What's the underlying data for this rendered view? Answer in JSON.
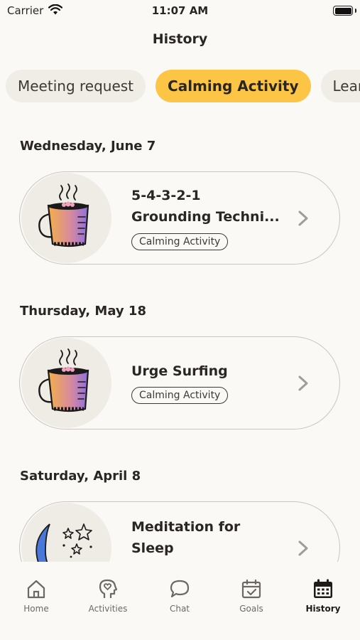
{
  "status": {
    "carrier": "Carrier",
    "time": "11:07 AM"
  },
  "header": {
    "title": "History"
  },
  "filters": [
    {
      "label": "Meeting request",
      "active": false
    },
    {
      "label": "Calming Activity",
      "active": true
    },
    {
      "label": "Learn w",
      "active": false
    }
  ],
  "sections": [
    {
      "date": "Wednesday, June 7",
      "card": {
        "title": "5-4-3-2-1 Grounding Techni...",
        "tag": "Calming Activity",
        "icon": "coffee-cup"
      }
    },
    {
      "date": "Thursday, May 18",
      "card": {
        "title": "Urge Surfing",
        "tag": "Calming Activity",
        "icon": "coffee-cup"
      }
    },
    {
      "date": "Saturday, April 8",
      "card": {
        "title": "Meditation for Sleep",
        "tag": "",
        "icon": "moon-stars"
      }
    }
  ],
  "tabs": [
    {
      "label": "Home",
      "icon": "home-icon",
      "active": false
    },
    {
      "label": "Activities",
      "icon": "head-heart-icon",
      "active": false
    },
    {
      "label": "Chat",
      "icon": "chat-bubble-icon",
      "active": false
    },
    {
      "label": "Goals",
      "icon": "calendar-check-icon",
      "active": false
    },
    {
      "label": "History",
      "icon": "calendar-icon",
      "active": true
    }
  ]
}
